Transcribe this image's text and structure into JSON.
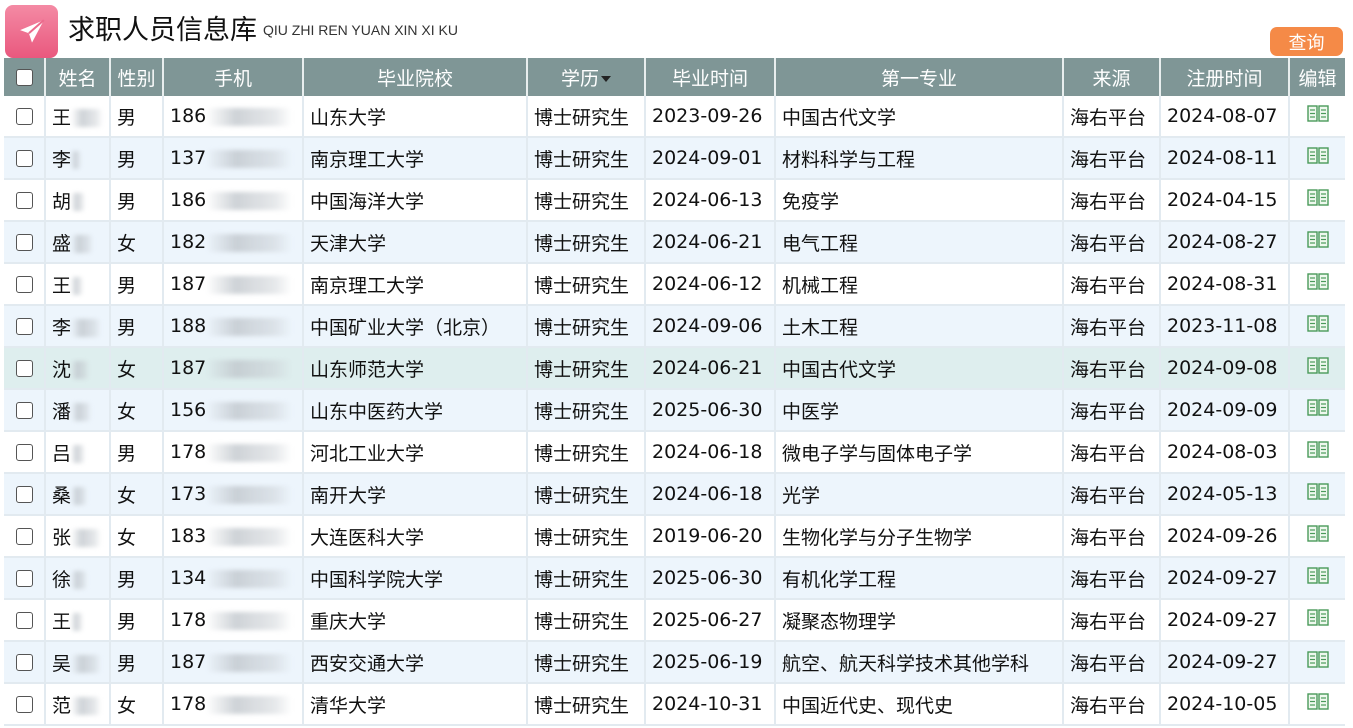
{
  "header": {
    "title": "求职人员信息库",
    "subtitle": "QIU ZHI REN YUAN XIN XI KU",
    "logo_icon": "paper-plane-icon",
    "query_label": "查询"
  },
  "colors": {
    "header_bg": "#7f9696",
    "query_button": "#f58a47",
    "logo": "#ec6a8c",
    "row_alt": "#edf5fc",
    "edit_icon": "#4a9a5a"
  },
  "table": {
    "columns": [
      "",
      "姓名",
      "性别",
      "手机",
      "毕业院校",
      "学历",
      "毕业时间",
      "第一专业",
      "来源",
      "注册时间",
      "编辑"
    ],
    "sort_icon": "caret-down-icon",
    "edit_icon": "book-icon",
    "rows": [
      {
        "name": "王",
        "gender": "男",
        "phone": "186",
        "school": "山东大学",
        "degree": "博士研究生",
        "grad_date": "2023-09-26",
        "major": "中国古代文学",
        "source": "海右平台",
        "reg_date": "2024-08-07"
      },
      {
        "name": "李",
        "gender": "男",
        "phone": "137",
        "school": "南京理工大学",
        "degree": "博士研究生",
        "grad_date": "2024-09-01",
        "major": "材料科学与工程",
        "source": "海右平台",
        "reg_date": "2024-08-11"
      },
      {
        "name": "胡",
        "gender": "男",
        "phone": "186",
        "school": "中国海洋大学",
        "degree": "博士研究生",
        "grad_date": "2024-06-13",
        "major": "免疫学",
        "source": "海右平台",
        "reg_date": "2024-04-15"
      },
      {
        "name": "盛",
        "gender": "女",
        "phone": "182",
        "school": "天津大学",
        "degree": "博士研究生",
        "grad_date": "2024-06-21",
        "major": "电气工程",
        "source": "海右平台",
        "reg_date": "2024-08-27"
      },
      {
        "name": "王",
        "gender": "男",
        "phone": "187",
        "school": "南京理工大学",
        "degree": "博士研究生",
        "grad_date": "2024-06-12",
        "major": "机械工程",
        "source": "海右平台",
        "reg_date": "2024-08-31"
      },
      {
        "name": "李",
        "gender": "男",
        "phone": "188",
        "school": "中国矿业大学（北京）",
        "degree": "博士研究生",
        "grad_date": "2024-09-06",
        "major": "土木工程",
        "source": "海右平台",
        "reg_date": "2023-11-08"
      },
      {
        "name": "沈",
        "gender": "女",
        "phone": "187",
        "school": "山东师范大学",
        "degree": "博士研究生",
        "grad_date": "2024-06-21",
        "major": "中国古代文学",
        "source": "海右平台",
        "reg_date": "2024-09-08"
      },
      {
        "name": "潘",
        "gender": "女",
        "phone": "156",
        "school": "山东中医药大学",
        "degree": "博士研究生",
        "grad_date": "2025-06-30",
        "major": "中医学",
        "source": "海右平台",
        "reg_date": "2024-09-09"
      },
      {
        "name": "吕",
        "gender": "男",
        "phone": "178",
        "school": "河北工业大学",
        "degree": "博士研究生",
        "grad_date": "2024-06-18",
        "major": "微电子学与固体电子学",
        "source": "海右平台",
        "reg_date": "2024-08-03"
      },
      {
        "name": "桑",
        "gender": "女",
        "phone": "173",
        "school": "南开大学",
        "degree": "博士研究生",
        "grad_date": "2024-06-18",
        "major": "光学",
        "source": "海右平台",
        "reg_date": "2024-05-13"
      },
      {
        "name": "张",
        "gender": "女",
        "phone": "183",
        "school": "大连医科大学",
        "degree": "博士研究生",
        "grad_date": "2019-06-20",
        "major": "生物化学与分子生物学",
        "source": "海右平台",
        "reg_date": "2024-09-26"
      },
      {
        "name": "徐",
        "gender": "男",
        "phone": "134",
        "school": "中国科学院大学",
        "degree": "博士研究生",
        "grad_date": "2025-06-30",
        "major": "有机化学工程",
        "source": "海右平台",
        "reg_date": "2024-09-27"
      },
      {
        "name": "王",
        "gender": "男",
        "phone": "178",
        "school": "重庆大学",
        "degree": "博士研究生",
        "grad_date": "2025-06-27",
        "major": "凝聚态物理学",
        "source": "海右平台",
        "reg_date": "2024-09-27"
      },
      {
        "name": "吴",
        "gender": "男",
        "phone": "187",
        "school": "西安交通大学",
        "degree": "博士研究生",
        "grad_date": "2025-06-19",
        "major": "航空、航天科学技术其他学科",
        "source": "海右平台",
        "reg_date": "2024-09-27"
      },
      {
        "name": "范",
        "gender": "女",
        "phone": "178",
        "school": "清华大学",
        "degree": "博士研究生",
        "grad_date": "2024-10-31",
        "major": "中国近代史、现代史",
        "source": "海右平台",
        "reg_date": "2024-10-05"
      }
    ]
  }
}
